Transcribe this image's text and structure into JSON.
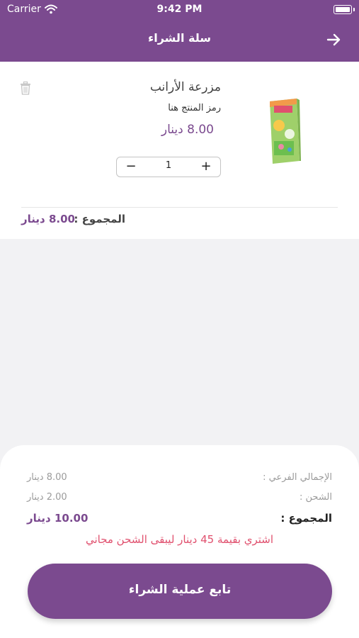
{
  "status_bar": {
    "carrier": "Carrier",
    "time": "9:42 PM"
  },
  "header": {
    "title": "سلة الشراء"
  },
  "cart_item": {
    "name": "مزرعة الأرانب",
    "code": "رمز المنتج هنا",
    "price": "8.00 دينار",
    "quantity": "1",
    "total_label": "المجموع :",
    "total_value": "8.00 دينار"
  },
  "summary": {
    "subtotal_label": "الإجمالي الفرعي :",
    "subtotal_value": "8.00 دينار",
    "shipping_label": "الشحن :",
    "shipping_value": "2.00 دينار",
    "total_label": "المجموع :",
    "total_value": "10.00 دينار",
    "promo": "اشتري بقيمة 45 دينار ليبقى الشحن مجاني"
  },
  "checkout_button": {
    "label": "تابع عملية الشراء"
  },
  "colors": {
    "brand": "#7b4a8f",
    "promo": "#e0506e",
    "muted": "#9b9b9b"
  },
  "icons": [
    "wifi-icon",
    "battery-icon",
    "back-arrow-icon",
    "trash-icon",
    "minus-icon",
    "plus-icon"
  ]
}
